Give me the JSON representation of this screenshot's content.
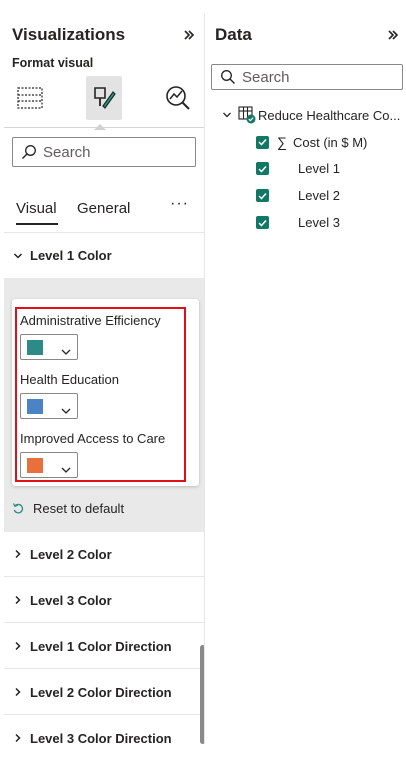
{
  "viz_pane": {
    "title": "Visualizations",
    "subtitle": "Format visual",
    "search_placeholder": "Search",
    "tabs": [
      {
        "label": "Visual",
        "active": true
      },
      {
        "label": "General",
        "active": false
      }
    ],
    "more_label": "···",
    "expanded_section": {
      "label": "Level 1 Color",
      "items": [
        {
          "label": "Administrative Efficiency",
          "color": "#2e8a86"
        },
        {
          "label": "Health Education",
          "color": "#4a84c4"
        },
        {
          "label": "Improved Access to Care",
          "color": "#e8703a"
        }
      ],
      "reset_label": "Reset to default"
    },
    "collapsed_sections": [
      {
        "label": "Level 2 Color"
      },
      {
        "label": "Level 3 Color"
      },
      {
        "label": "Level 1 Color Direction"
      },
      {
        "label": "Level 2 Color Direction"
      },
      {
        "label": "Level 3 Color Direction"
      }
    ]
  },
  "data_pane": {
    "title": "Data",
    "search_placeholder": "Search",
    "table": {
      "name": "Reduce Healthcare Co...",
      "fields": [
        {
          "label": "Cost (in $ M)",
          "measure_symbol": "∑",
          "checked": true
        },
        {
          "label": "Level 1",
          "checked": true
        },
        {
          "label": "Level 2",
          "checked": true
        },
        {
          "label": "Level 3",
          "checked": true
        }
      ]
    }
  },
  "colors": {
    "checkbox": "#117865",
    "highlight_outline": "#e0101a",
    "expanded_background": "#e9e9e9"
  }
}
